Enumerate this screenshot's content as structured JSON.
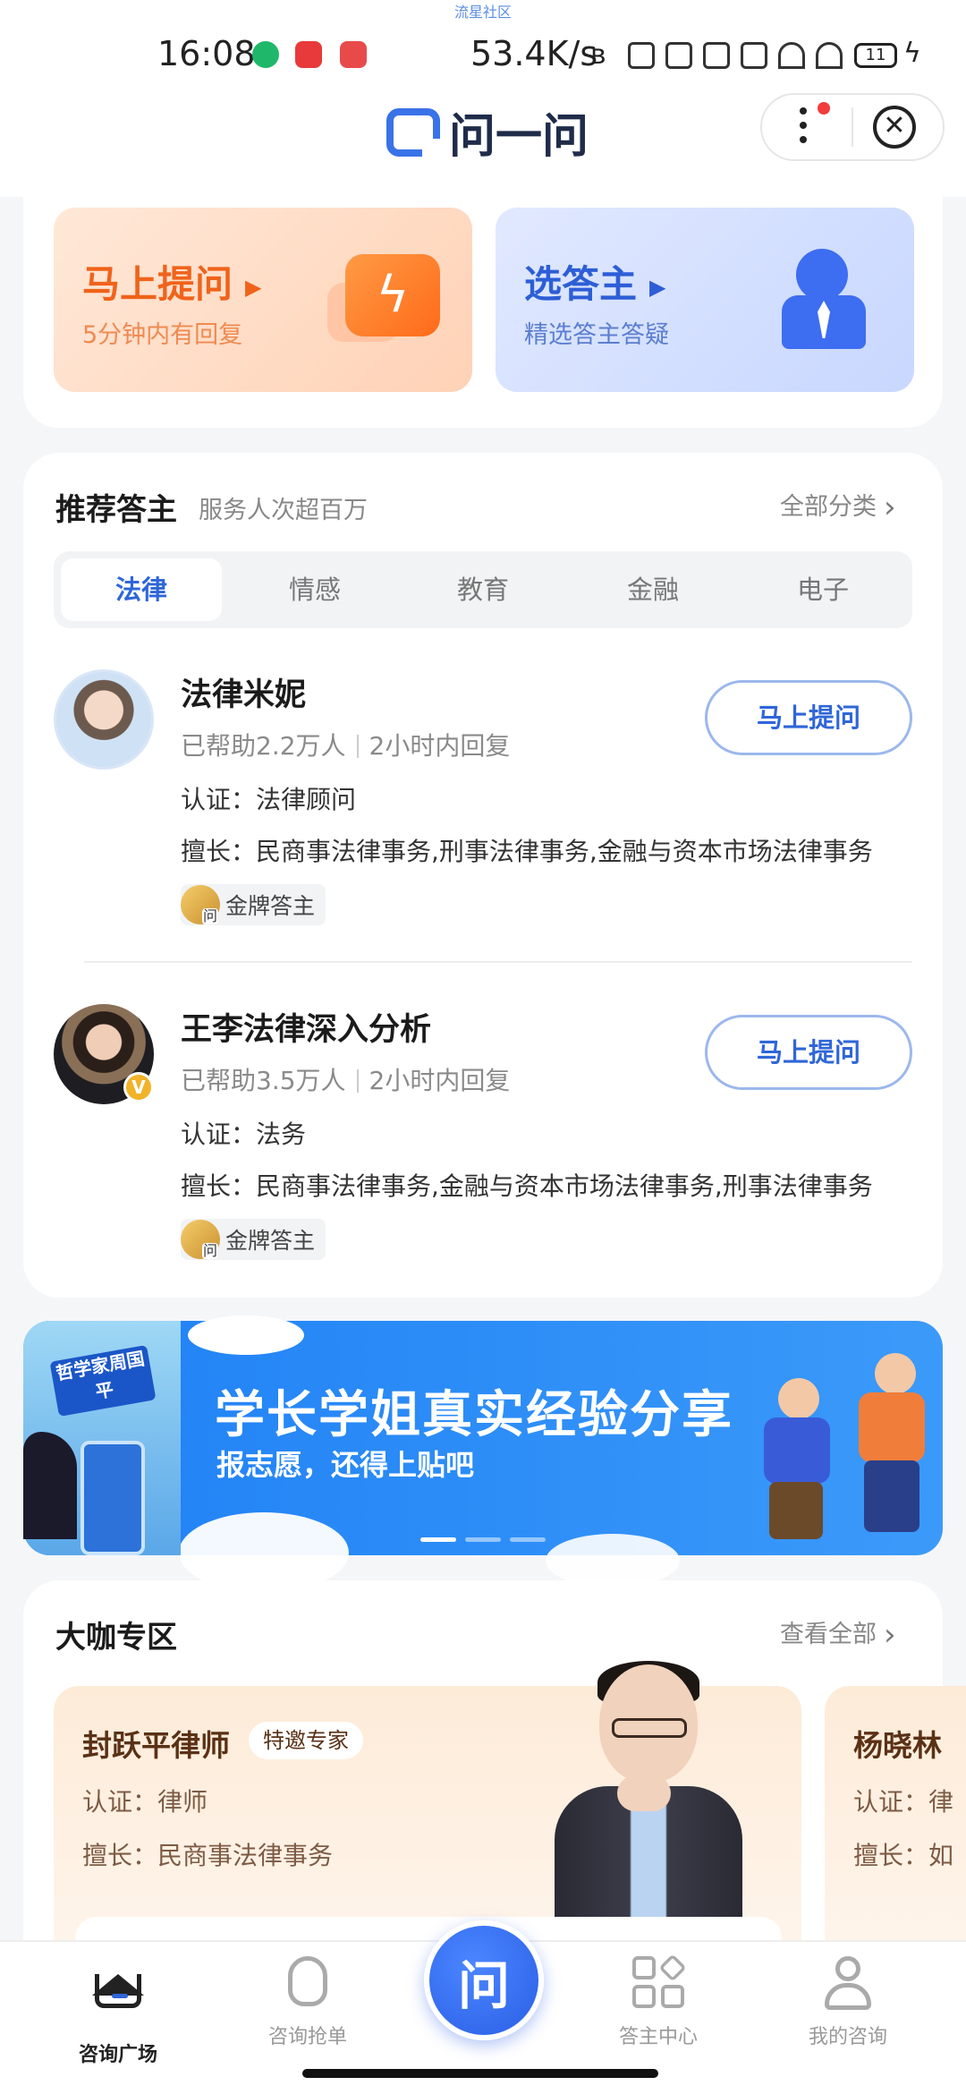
{
  "status_bar": {
    "carrier_top": "流星社区",
    "time": "16:08",
    "net_speed": "53.4K/s",
    "battery": "11"
  },
  "header": {
    "app_name": "问一问",
    "more_icon": "more-dots-icon",
    "close_icon": "close-circle-icon",
    "close_glyph": "✕"
  },
  "quick_actions": [
    {
      "title": "马上提问",
      "subtitle": "5分钟内有回复",
      "icon": "lightning-bubble-icon",
      "color": "#f0631b"
    },
    {
      "title": "选答主",
      "subtitle": "精选答主答疑",
      "icon": "person-tie-icon",
      "color": "#2d5ed6"
    }
  ],
  "recommended": {
    "title": "推荐答主",
    "subtitle": "服务人次超百万",
    "more_label": "全部分类",
    "tabs": [
      "法律",
      "情感",
      "教育",
      "金融",
      "电子"
    ],
    "active_tab": 0,
    "experts": [
      {
        "name": "法律米妮",
        "helped": "已帮助2.2万人",
        "reply": "2小时内回复",
        "cert": "认证：法律顾问",
        "skills": "擅长：民商事法律事务,刑事法律事务,金融与资本市场法律事务",
        "badge": "金牌答主",
        "button": "马上提问",
        "verified": false
      },
      {
        "name": "王李法律深入分析",
        "helped": "已帮助3.5万人",
        "reply": "2小时内回复",
        "cert": "认证：法务",
        "skills": "擅长：民商事法律事务,金融与资本市场法律事务,刑事法律事务",
        "badge": "金牌答主",
        "button": "马上提问",
        "verified": true,
        "verified_mark": "V"
      }
    ]
  },
  "banner": {
    "tag": "哲学家周国平",
    "title": "学长学姐真实经验分享",
    "subtitle": "报志愿，还得上贴吧"
  },
  "big_shots": {
    "title": "大咖专区",
    "more_label": "查看全部",
    "cards": [
      {
        "name": "封跃平律师",
        "badge": "特邀专家",
        "cert": "认证：律师",
        "skills": "擅长：民商事法律事务"
      },
      {
        "name": "杨晓林",
        "cert": "认证：律",
        "skills": "擅长：如"
      }
    ]
  },
  "bottom_nav": {
    "items": [
      "咨询广场",
      "咨询抢单",
      "答主中心",
      "我的咨询"
    ],
    "center_label": "问",
    "active": 0
  },
  "colors": {
    "accent": "#2f66d8",
    "orange": "#f0631b",
    "background": "#f5f6f8"
  }
}
